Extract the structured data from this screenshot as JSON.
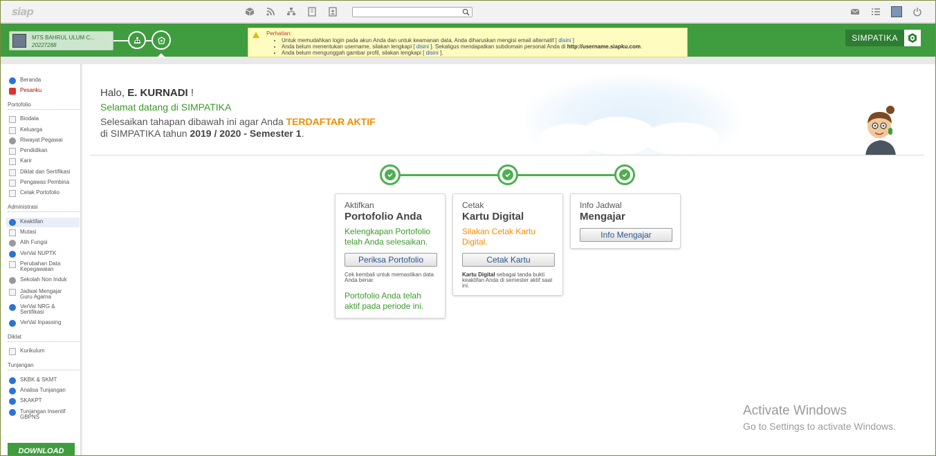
{
  "app": {
    "logo": "siap"
  },
  "header": {
    "user_name": "MTS BAHRUL ULUM C...",
    "user_id": "20227288",
    "brand": "SIMPATIKA",
    "alert": {
      "title": "Perhatian:",
      "items": [
        {
          "text": "Untuk memudahkan login pada akun Anda dan untuk keamanan data, Anda diharuskan mengisi email alternatif [",
          "link": "disini",
          "after": "]"
        },
        {
          "text": "Anda belum menentukan username, silakan lengkapi [",
          "link": "disini",
          "after": "]. Sekaligus mendapatkan subdomain personal Anda di",
          "bold": "http://username.siapku.com",
          "tail": "."
        },
        {
          "text": "Anda belum mengunggah gambar profil, silakan lengkapi [",
          "link": "disini",
          "after": "]."
        }
      ]
    }
  },
  "sidebar": {
    "items_top": [
      {
        "label": "Beranda"
      },
      {
        "label": "Pesanku"
      }
    ],
    "sections": [
      {
        "heading": "Portofolio",
        "items": [
          "Biodata",
          "Keluarga",
          "Riwayat Pegawai",
          "Pendidikan",
          "Karir",
          "Diklat dan Sertifikasi",
          "Pengawas Pembina",
          "Cetak Portofolio"
        ]
      },
      {
        "heading": "Administrasi",
        "items": [
          "Keaktifan",
          "Mutasi",
          "Alih Fungsi",
          "VerVal NUPTK",
          "Perubahan Data Kepegawaian",
          "Sekolah Non Induk",
          "Jadwal Mengajar Guru Agama",
          "VerVal NRG & Sertifikasi",
          "VerVal Inpassing"
        ]
      },
      {
        "heading": "Diklat",
        "items": [
          "Kurikulum"
        ]
      },
      {
        "heading": "Tunjangan",
        "items": [
          "SKBK & SKMT",
          "Analisa Tunjangan",
          "SKAKPT",
          "Tunjangan Insentif GBPNS"
        ]
      }
    ],
    "download": "DOWNLOAD"
  },
  "main": {
    "greeting_prefix": "Halo,",
    "greeting_name": "E. KURNADI",
    "greeting_suffix": "!",
    "welcome": "Selamat datang di SIMPATIKA",
    "instr_1": "Selesaikan tahapan dibawah ini agar Anda",
    "instr_hl": "TERDAFTAR AKTIF",
    "instr_2": "di SIMPATIKA tahun",
    "instr_year": "2019 / 2020 - Semester 1",
    "instr_end": ".",
    "cards": [
      {
        "kicker": "Aktifkan",
        "title": "Portofolio Anda",
        "status": "Kelengkapan Portofolio telah Anda selesaikan.",
        "button": "Periksa Portofolio",
        "note": "Cek kembali untuk memastikan data Anda benar.",
        "footer": "Portofolio Anda telah aktif pada periode ini."
      },
      {
        "kicker": "Cetak",
        "title": "Kartu Digital",
        "status": "Silakan Cetak Kartu Digital.",
        "button": "Cetak Kartu",
        "note_bold": "Kartu Digital",
        "note": "sebagai tanda bukti keaktifan Anda di semester aktif saat ini."
      },
      {
        "kicker": "Info Jadwal",
        "title": "Mengajar",
        "button": "Info Mengajar"
      }
    ]
  },
  "watermark": {
    "title": "Activate Windows",
    "subtitle": "Go to Settings to activate Windows."
  }
}
